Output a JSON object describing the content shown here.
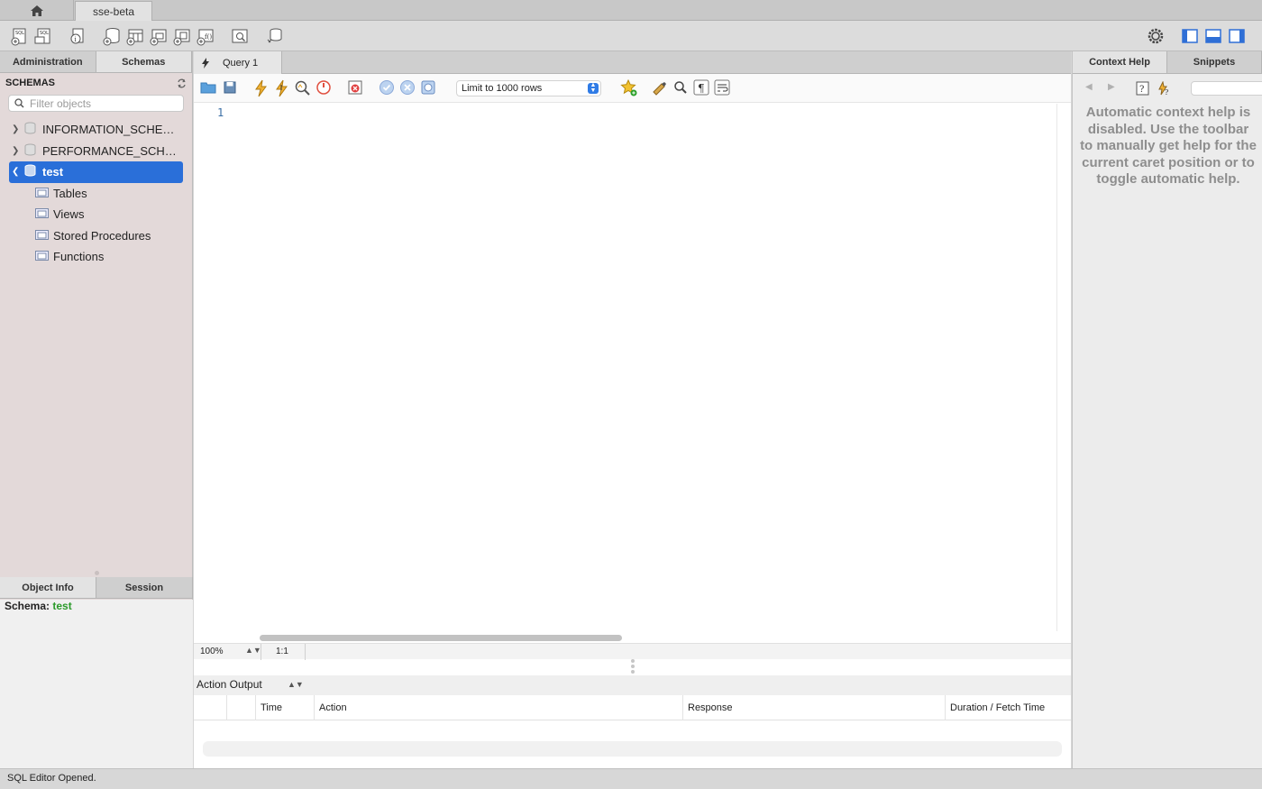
{
  "window": {
    "connection_tab": "sse-beta"
  },
  "sidebar": {
    "tabs": [
      "Administration",
      "Schemas"
    ],
    "schemas_header": "SCHEMAS",
    "filter_placeholder": "Filter objects",
    "schemas": [
      {
        "name": "INFORMATION_SCHEMA",
        "expanded": false
      },
      {
        "name": "PERFORMANCE_SCHEMA",
        "display": "PERFORMANCE_SCHE...",
        "expanded": false
      },
      {
        "name": "test",
        "expanded": true,
        "selected": true
      }
    ],
    "children": [
      "Tables",
      "Views",
      "Stored Procedures",
      "Functions"
    ],
    "info_tabs": [
      "Object Info",
      "Session"
    ],
    "info": {
      "label": "Schema:",
      "value": "test"
    }
  },
  "editor": {
    "query_tab": "Query 1",
    "limit_select": "Limit to 1000 rows",
    "line_number": "1",
    "zoom": "100%",
    "caret_position": "1:1"
  },
  "output": {
    "selector": "Action Output",
    "columns": [
      "",
      "",
      "Time",
      "Action",
      "Response",
      "Duration / Fetch Time"
    ]
  },
  "right_panel": {
    "tabs": [
      "Context Help",
      "Snippets"
    ],
    "help_text": "Automatic context help is disabled. Use the toolbar to manually get help for the current caret position or to toggle automatic help."
  },
  "statusbar": {
    "message": "SQL Editor Opened."
  },
  "colors": {
    "selection": "#2a6fd9",
    "sidebar_bg": "#e3d9d9",
    "schema_value": "#2a9a2a",
    "help_text": "#8e8e8e"
  }
}
